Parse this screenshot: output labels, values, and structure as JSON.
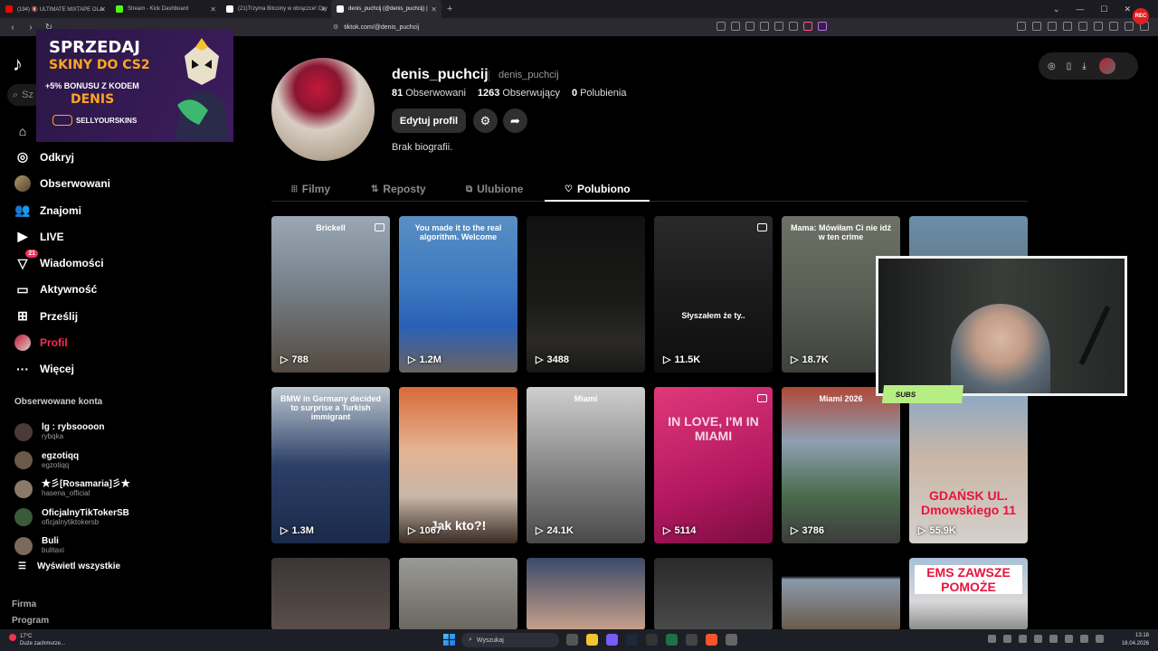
{
  "browser": {
    "tabs": [
      {
        "label": "(194) 🔇 ULTIMATE MIXTAPE OLA",
        "color": "#ff0000",
        "active": false
      },
      {
        "label": "Stream - Kick Dashboard",
        "color": "#53fc18",
        "active": false
      },
      {
        "label": "(21)Trzyma Bitcoiny w obrączce! Czy",
        "color": "#ffffff",
        "active": false
      },
      {
        "label": "denis_puchcij (@denis_puchcij) |",
        "color": "#ffffff",
        "active": true
      }
    ],
    "url": "tiktok.com/@denis_puchcij",
    "new_tab": "+",
    "record_badge": "REC"
  },
  "ad": {
    "line1": "SPRZEDAJ",
    "line2": "SKINY DO CS2",
    "line3": "+5% BONUSU Z KODEM",
    "line4": "DENIS",
    "brand": "SELLYOURSKINS"
  },
  "sidebar": {
    "search_placeholder": "Sz",
    "nav": [
      {
        "label": "Dla Ciebie",
        "icon": "home-icon",
        "glyph": "⌂"
      },
      {
        "label": "Odkryj",
        "icon": "compass-icon",
        "glyph": "◎"
      },
      {
        "label": "Obserwowani",
        "icon": "avatar-icon",
        "glyph": ""
      },
      {
        "label": "Znajomi",
        "icon": "friends-icon",
        "glyph": "👥"
      },
      {
        "label": "LIVE",
        "icon": "live-icon",
        "glyph": "▶"
      },
      {
        "label": "Wiadomości",
        "icon": "messages-icon",
        "glyph": "▽",
        "badge": "21"
      },
      {
        "label": "Aktywność",
        "icon": "activity-icon",
        "glyph": "▭"
      },
      {
        "label": "Prześlij",
        "icon": "upload-icon",
        "glyph": "⊞"
      },
      {
        "label": "Profil",
        "icon": "profile-avatar-icon",
        "glyph": "",
        "active": true
      },
      {
        "label": "Więcej",
        "icon": "more-icon",
        "glyph": "···"
      }
    ],
    "following_title": "Obserwowane konta",
    "accounts": [
      {
        "name": "lg : rybsoooon",
        "handle": "rybqka"
      },
      {
        "name": "egzotiqq",
        "handle": "egzotiqq"
      },
      {
        "name": "★彡[Rosamaria]彡★",
        "handle": "hasena_official"
      },
      {
        "name": "OficjalnyTikTokerSB",
        "handle": "oficjalnytiktokersb"
      },
      {
        "name": "Buli",
        "handle": "bulitaxi"
      }
    ],
    "show_all": "Wyświetl wszystkie",
    "footer": [
      "Firma",
      "Program"
    ]
  },
  "profile": {
    "username": "denis_puchcij",
    "nickname": "denis_puchcij",
    "following_count": "81",
    "following_label": "Obserwowani",
    "followers_count": "1263",
    "followers_label": "Obserwujący",
    "likes_count": "0",
    "likes_label": "Polubienia",
    "edit_label": "Edytuj profil",
    "bio": "Brak biografii."
  },
  "tabs": [
    {
      "label": "Filmy",
      "glyph": "⦙⦙⦙"
    },
    {
      "label": "Reposty",
      "glyph": "⇅"
    },
    {
      "label": "Ulubione",
      "glyph": "⧉"
    },
    {
      "label": "Polubiono",
      "glyph": "♡",
      "active": true
    }
  ],
  "videos": [
    {
      "views": "788",
      "caption": "Brickell",
      "bg": "linear-gradient(180deg,#9aa7b4 0%,#7a8590 40%,#544a40 100%)",
      "pinned": true
    },
    {
      "views": "1.2M",
      "caption": "You made it to the real algorithm. Welcome",
      "bg": "linear-gradient(180deg,#5a8fc4 0%,#3b78c0 45%,#2a60b8 70%,#6a6460 100%)",
      "pinned": false
    },
    {
      "views": "3488",
      "caption": "",
      "bg": "linear-gradient(180deg,#111 0%,#1a1a18 55%,#2b2a26 80%,#181816 100%)",
      "pinned": false
    },
    {
      "views": "11.5K",
      "caption": "Słyszałem że ty..",
      "bg": "linear-gradient(180deg,#2a2a2a 0%,#1a1a1a 50%,#0e0e0e 100%)",
      "pinned": true
    },
    {
      "views": "18.7K",
      "caption": "Mama: Mówiłam Ci nie idź w ten crime",
      "bg": "linear-gradient(180deg,#6d7166 0%,#5a5e54 50%,#3f423c 100%)",
      "pinned": false
    },
    {
      "views": "",
      "caption": "",
      "bg": "linear-gradient(180deg,#6d8eab 0%,#4a5a4a 100%)",
      "pinned": false
    },
    {
      "views": "1.3M",
      "caption": "BMW in Germany decided to surprise a Turkish immigrant",
      "bg": "linear-gradient(180deg,#bcc6cf 0%,#2c3f67 50%,#1b2a4a 100%)",
      "pinned": false
    },
    {
      "views": "1067",
      "caption": "Jak kto?!",
      "bg": "linear-gradient(180deg,#d86a3a 0%,#e4b390 40%,#c8b6a8 70%,#3a2c24 100%)",
      "pinned": false
    },
    {
      "views": "24.1K",
      "caption": "Miami",
      "bg": "linear-gradient(180deg,#cfcfcf 0%,#8a8a8a 50%,#4a4a4a 100%)",
      "pinned": false
    },
    {
      "views": "5114",
      "caption": "IN LOVE, I'M IN MIAMI",
      "bg": "linear-gradient(160deg,#e0387a 0%,#b31860 60%,#7a0c40 100%)",
      "pinned": true
    },
    {
      "views": "3786",
      "caption": "Miami 2026",
      "bg": "linear-gradient(180deg,#b04838 0%,#8da0b3 35%,#4a6a4a 70%,#3c3c3c 100%)",
      "pinned": false
    },
    {
      "views": "55.9K",
      "caption": "GDAŃSK UL. Dmowskiego 11",
      "bg": "linear-gradient(180deg,#87a8c7 0%,#c9b6a6 45%,#d4d0cc 100%)",
      "pinned": false
    },
    {
      "views": "",
      "caption": "",
      "bg": "linear-gradient(180deg,#3a3636 0%,#5a4e4a 100%)",
      "pinned": false
    },
    {
      "views": "",
      "caption": "",
      "bg": "linear-gradient(180deg,#9a9a96 0%,#6a6660 100%)",
      "pinned": false
    },
    {
      "views": "",
      "caption": "",
      "bg": "linear-gradient(180deg,#3a4a6a 0%,#c8a08a 100%)",
      "pinned": false
    },
    {
      "views": "",
      "caption": "",
      "bg": "linear-gradient(180deg,#2a2a2a 0%,#4a4a4a 100%)",
      "pinned": false
    },
    {
      "views": "",
      "caption": "",
      "bg": "linear-gradient(180deg,#000 0%,#000 25%,#8a9aaa 30%,#6a5a4a 100%)",
      "pinned": false
    },
    {
      "views": "",
      "caption": "EMS ZAWSZE POMOŻE",
      "bg": "linear-gradient(180deg,#a8c0d8 0%,#d8d8d8 60%,#8a8a8a 100%)",
      "pinned": false
    }
  ],
  "webcam": {
    "overlay_label": "SUBS"
  },
  "taskbar": {
    "temp": "17°C",
    "weather": "Duże zachmurze...",
    "search": "Wyszukaj",
    "time": "13:18",
    "date": "16.04.2026"
  }
}
